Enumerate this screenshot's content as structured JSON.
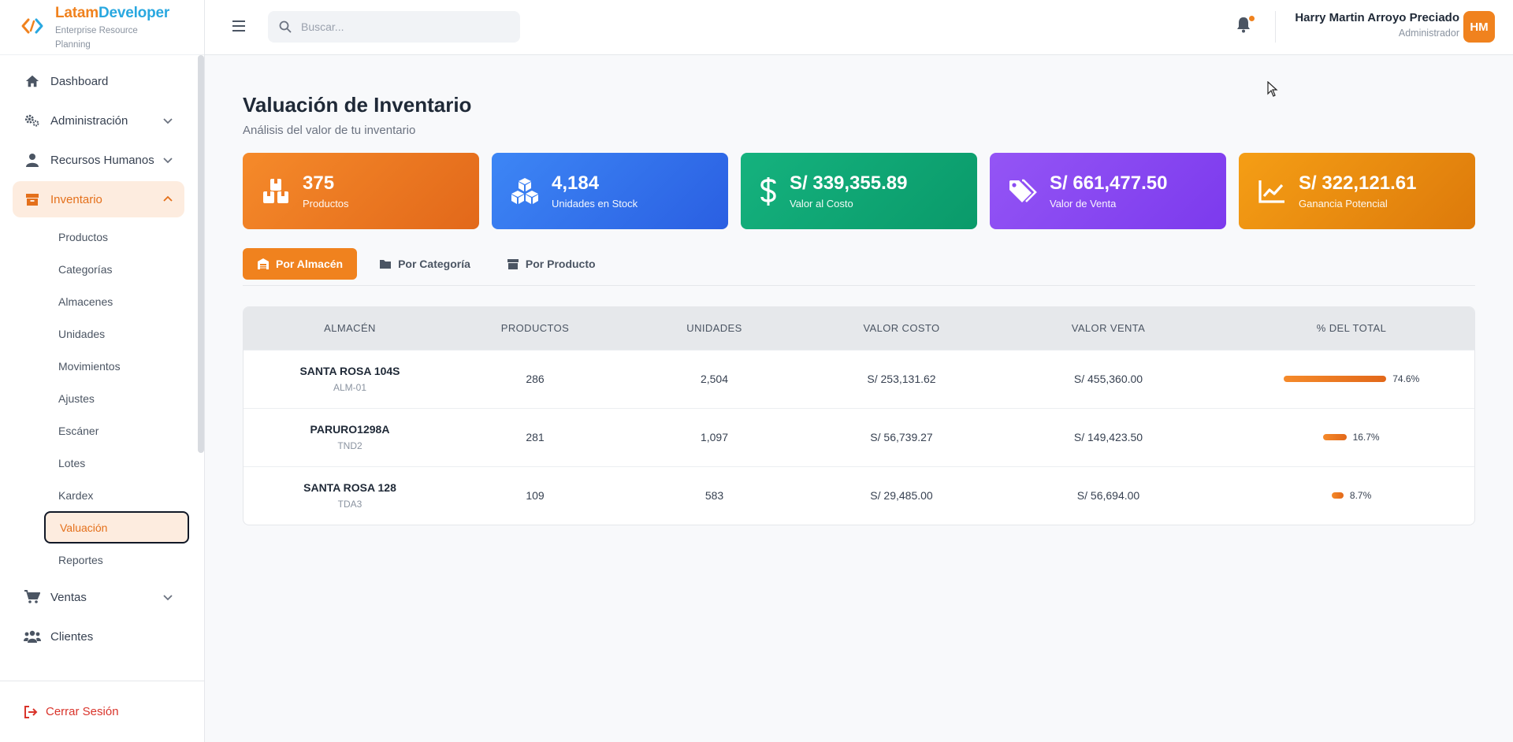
{
  "brand": {
    "name_a": "Latam",
    "name_b": "Developer",
    "subtitle": "Enterprise Resource Planning"
  },
  "sidebar": {
    "items": [
      {
        "label": "Dashboard",
        "icon": "home-icon"
      },
      {
        "label": "Administración",
        "icon": "gears-icon"
      },
      {
        "label": "Recursos Humanos",
        "icon": "user-icon"
      },
      {
        "label": "Inventario",
        "icon": "box-icon"
      }
    ],
    "inventory_sub": [
      "Productos",
      "Categorías",
      "Almacenes",
      "Unidades",
      "Movimientos",
      "Ajustes",
      "Escáner",
      "Lotes",
      "Kardex",
      "Valuación",
      "Reportes"
    ],
    "after": [
      {
        "label": "Ventas",
        "icon": "cart-icon"
      },
      {
        "label": "Clientes",
        "icon": "users-icon"
      }
    ],
    "logout": "Cerrar Sesión"
  },
  "header": {
    "search_placeholder": "Buscar...",
    "user_name": "Harry Martin Arroyo Preciado",
    "user_role": "Administrador",
    "avatar_initials": "HM"
  },
  "page": {
    "title": "Valuación de Inventario",
    "subtitle": "Análisis del valor de tu inventario"
  },
  "cards": [
    {
      "value": "375",
      "label": "Productos"
    },
    {
      "value": "4,184",
      "label": "Unidades en Stock"
    },
    {
      "value": "S/ 339,355.89",
      "label": "Valor al Costo"
    },
    {
      "value": "S/ 661,477.50",
      "label": "Valor de Venta"
    },
    {
      "value": "S/ 322,121.61",
      "label": "Ganancia Potencial"
    }
  ],
  "tabs": [
    "Por Almacén",
    "Por Categoría",
    "Por Producto"
  ],
  "table": {
    "headers": [
      "ALMACÉN",
      "PRODUCTOS",
      "UNIDADES",
      "VALOR COSTO",
      "VALOR VENTA",
      "% DEL TOTAL"
    ],
    "rows": [
      {
        "name": "SANTA ROSA 104S",
        "code": "ALM-01",
        "productos": "286",
        "unidades": "2,504",
        "costo": "S/ 253,131.62",
        "venta": "S/ 455,360.00",
        "pct_label": "74.6%",
        "pct": 74.6
      },
      {
        "name": "PARURO1298A",
        "code": "TND2",
        "productos": "281",
        "unidades": "1,097",
        "costo": "S/ 56,739.27",
        "venta": "S/ 149,423.50",
        "pct_label": "16.7%",
        "pct": 16.7
      },
      {
        "name": "SANTA ROSA 128",
        "code": "TDA3",
        "productos": "109",
        "unidades": "583",
        "costo": "S/ 29,485.00",
        "venta": "S/ 56,694.00",
        "pct_label": "8.7%",
        "pct": 8.7
      }
    ]
  },
  "colors": {
    "accent": "#f0821e",
    "brand_blue": "#29a8e0",
    "danger": "#d9342b"
  }
}
